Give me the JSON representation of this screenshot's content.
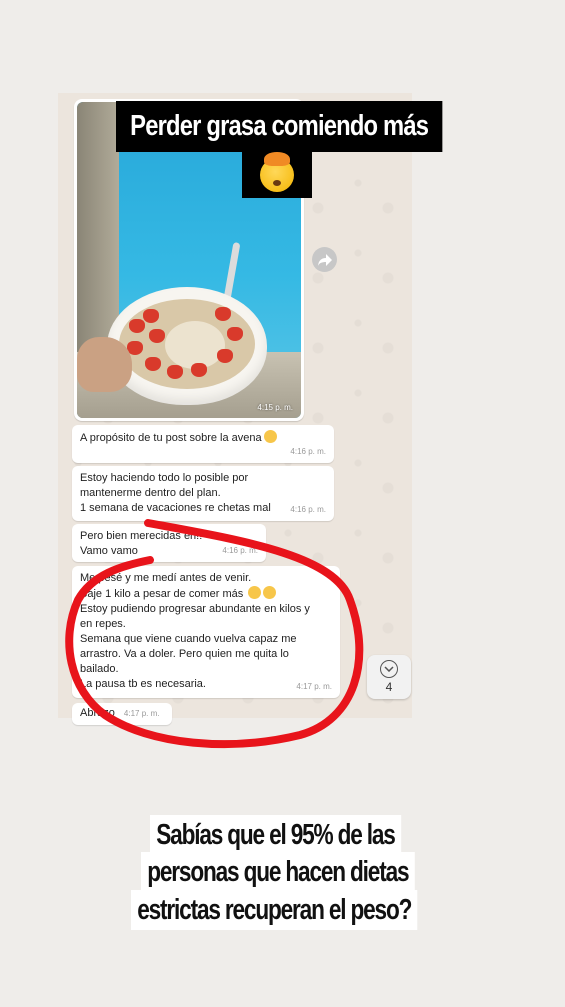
{
  "title_overlay": "Perder grasa comiendo más",
  "emoji_overlay": "mind-blown-emoji",
  "photo_message": {
    "time": "4:15 p. m."
  },
  "messages": [
    {
      "text": "A propósito de tu post sobre la avena",
      "emoji": "drooling-face",
      "time": "4:16 p. m."
    },
    {
      "line1": "Estoy haciendo todo lo posible por",
      "line2": "mantenerme dentro del plan.",
      "line3": "1 semana de vacaciones re chetas mal",
      "time": "4:16 p. m."
    },
    {
      "line1": "Pero bien merecidas eh!!",
      "line2": "Vamo vamo",
      "time": "4:16 p. m."
    },
    {
      "line1": "Me pesé y me medí antes de venir.",
      "line2": "Baje 1 kilo a pesar de comer más",
      "line3": "Estoy pudiendo progresar abundante en kilos y",
      "line4": "en repes.",
      "line5": "Semana que viene cuando vuelva capaz me",
      "line6": "arrastro. Va a doler. Pero quien me quita lo",
      "line7": "bailado.",
      "line8": "La pausa tb es necesaria.",
      "time": "4:17 p. m."
    },
    {
      "text": "Abrazo",
      "time": "4:17 p. m."
    }
  ],
  "scroll_down": {
    "count": "4"
  },
  "bottom_caption": {
    "line1": "Sabías que el 95% de las",
    "line2": "personas que hacen dietas",
    "line3": "estrictas recuperan el peso?"
  },
  "colors": {
    "highlight_circle": "#e8141b",
    "chat_bg": "#ece5dd",
    "banner_bg": "#000000"
  }
}
